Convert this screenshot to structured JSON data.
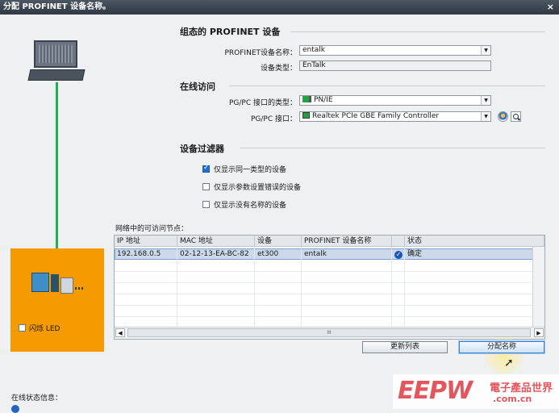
{
  "window": {
    "title": "分配 PROFINET 设备名称。",
    "close": "×"
  },
  "configured": {
    "heading": "组态的 PROFINET 设备",
    "name_label": "PROFINET设备名称：",
    "name_value": "entalk",
    "type_label": "设备类型：",
    "type_value": "EnTalk"
  },
  "online": {
    "heading": "在线访问",
    "iface_type_label": "PG/PC 接口的类型：",
    "iface_type_value": "PN/IE",
    "iface_label": "PG/PC 接口：",
    "iface_value": "Realtek PCIe GBE Family Controller"
  },
  "filter": {
    "heading": "设备过滤器",
    "options": [
      {
        "label": "仅显示同一类型的设备",
        "checked": true
      },
      {
        "label": "仅显示参数设置错误的设备",
        "checked": false
      },
      {
        "label": "仅显示没有名称的设备",
        "checked": false
      }
    ]
  },
  "nodes": {
    "caption": "网络中的可访问节点：",
    "columns": [
      "IP 地址",
      "MAC 地址",
      "设备",
      "PROFINET 设备名称",
      "状态"
    ],
    "rows": [
      {
        "ip": "192.168.0.5",
        "mac": "02-12-13-EA-BC-82",
        "device": "et300",
        "name": "entalk",
        "status": "确定"
      }
    ],
    "hscroll_thumb": "III"
  },
  "device_panel": {
    "flash_label": "闪烁 LED"
  },
  "buttons": {
    "refresh": "更新列表",
    "assign": "分配名称"
  },
  "status_area": {
    "label": "在线状态信息："
  },
  "watermark": {
    "logo": "EEPW",
    "cn": "電子產品世界",
    "url": ".com.cn"
  },
  "colors": {
    "accent": "#1f6fd1",
    "line": "#22b14c",
    "device_box": "#f59a00"
  }
}
